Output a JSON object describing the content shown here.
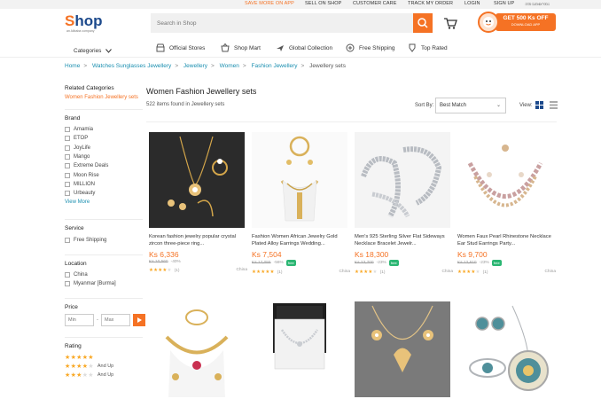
{
  "topbar": {
    "save_more": "SAVE MORE ON APP",
    "sell": "SELL ON SHOP",
    "care": "CUSTOMER CARE",
    "track": "TRACK MY ORDER",
    "login": "LOGIN",
    "signup": "SIGN UP",
    "lang": "ဘာသာစကား"
  },
  "header": {
    "logo_text": "Shop",
    "logo_sub": "an Alibaba company",
    "search_placeholder": "Search in Shop",
    "promo_line1": "GET 500 Ks OFF",
    "promo_line2": "DOWNLOAD APP",
    "brand_color": "#f57224"
  },
  "nav": {
    "categories": "Categories",
    "items": [
      "Official Stores",
      "Shop Mart",
      "Global Collection",
      "Free Shipping",
      "Top Rated"
    ]
  },
  "breadcrumb": [
    "Home",
    "Watches Sunglasses Jewellery",
    "Jewellery",
    "Women",
    "Fashion Jewellery",
    "Jewellery sets"
  ],
  "sidebar": {
    "related_title": "Related Categories",
    "related_link": "Women Fashion Jewellery sets",
    "brand_title": "Brand",
    "brands": [
      "Amamia",
      "ETOP",
      "JoyLife",
      "Mango",
      "Extreme Deals",
      "Moon Rise",
      "MILLION",
      "Urbeauty"
    ],
    "view_more": "View More",
    "service_title": "Service",
    "service_option": "Free Shipping",
    "location_title": "Location",
    "locations": [
      "China",
      "Myanmar [Burma]"
    ],
    "price_title": "Price",
    "price_min": "Min",
    "price_max": "Max",
    "price_dash": "-",
    "rating_title": "Rating",
    "and_up": "And Up"
  },
  "main": {
    "title": "Women Fashion Jewellery sets",
    "count": "522 items found in Jewellery sets",
    "sort_label": "Sort By:",
    "sort_value": "Best Match",
    "view_label": "View:"
  },
  "products": [
    {
      "name": "Korean fashion jewelry popular crystal zircon three-piece ring...",
      "price": "Ks 6,336",
      "orig": "Ks 10,560",
      "discount": "-40%",
      "free": false,
      "rating": 4,
      "reviews": "(1)",
      "location": "China"
    },
    {
      "name": "Fashion Women African Jewelry Gold Plated Alloy Earrings Wedding...",
      "price": "Ks 7,504",
      "orig": "Ks 17,055",
      "discount": "-56%",
      "free": true,
      "rating": 5,
      "reviews": "(1)",
      "location": "China"
    },
    {
      "name": "Men's 925 Sterling Silver Flat Sideways Necklace Bracelet Jewelr...",
      "price": "Ks 18,300",
      "orig": "Ks 23,700",
      "discount": "-23%",
      "free": true,
      "rating": 4,
      "reviews": "(1)",
      "location": "China"
    },
    {
      "name": "Women Faux Pearl Rhinestone Necklace Ear Stud Earrings Party...",
      "price": "Ks 9,700",
      "orig": "Ks 12,610",
      "discount": "-23%",
      "free": true,
      "rating": 4,
      "reviews": "(1)",
      "location": "China"
    }
  ],
  "free_badge": "free",
  "row2": [
    "gold-flower-necklace-set",
    "pearl-necklace-in-box",
    "silver-heart-necklace-set",
    "floral-glass-pendant-set"
  ]
}
